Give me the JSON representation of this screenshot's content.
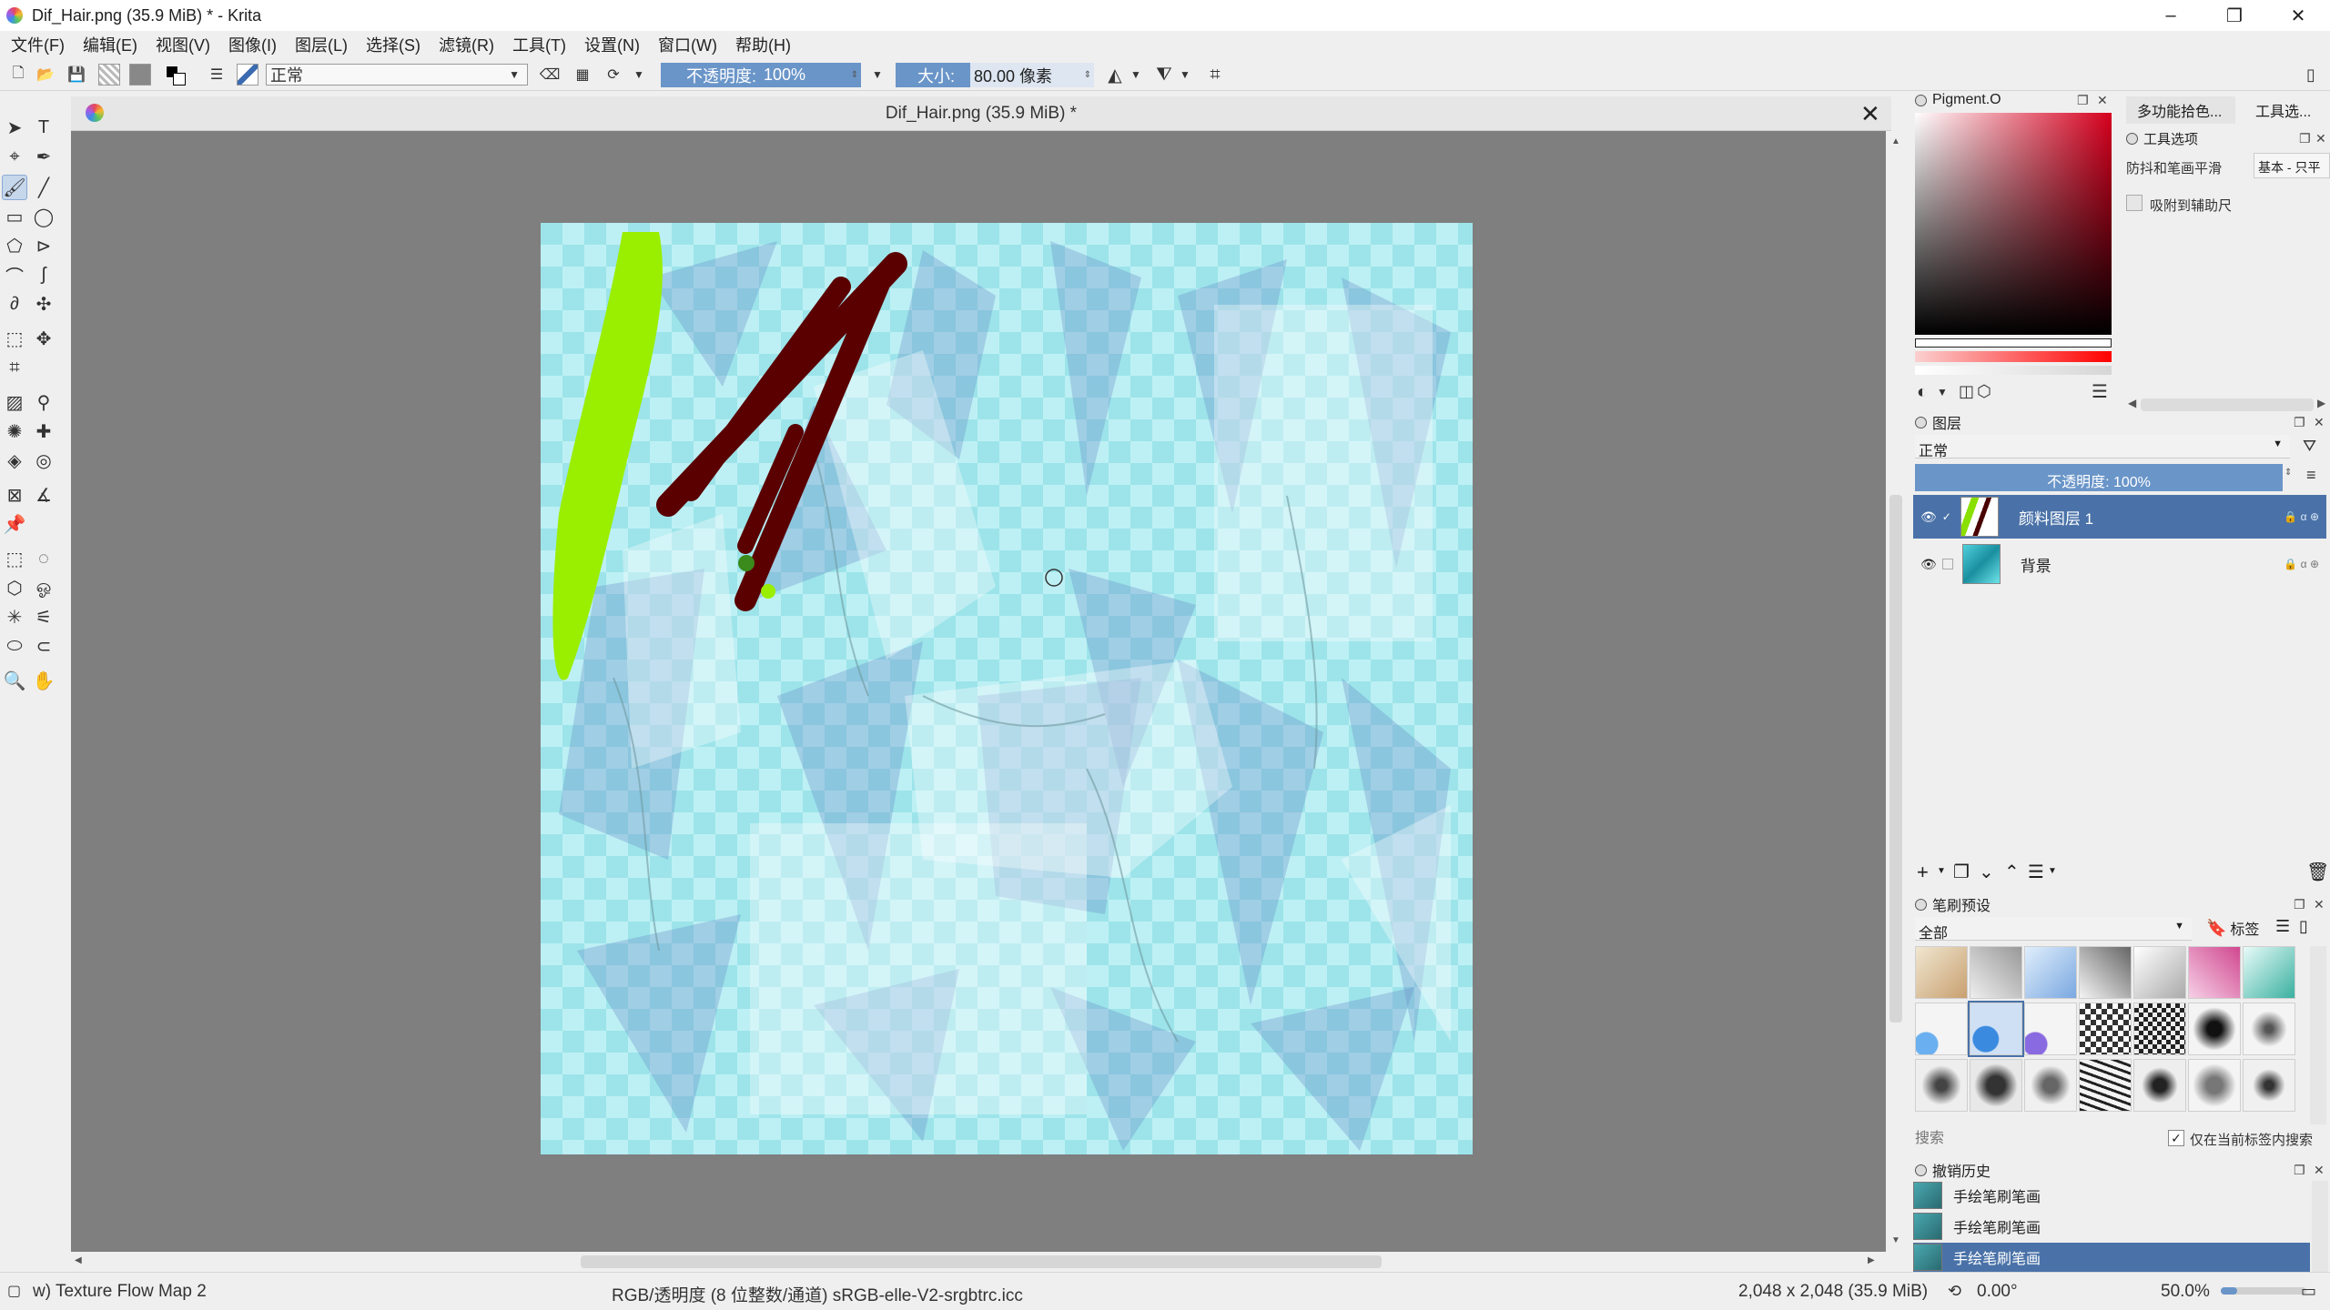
{
  "window": {
    "title": "Dif_Hair.png (35.9 MiB) * - Krita",
    "min": "–",
    "max": "❐",
    "close": "✕"
  },
  "menu": [
    "文件(F)",
    "编辑(E)",
    "视图(V)",
    "图像(I)",
    "图层(L)",
    "选择(S)",
    "滤镜(R)",
    "工具(T)",
    "设置(N)",
    "窗口(W)",
    "帮助(H)"
  ],
  "toolbar": {
    "blend_mode": "正常",
    "opacity_label": "不透明度:",
    "opacity_value": "100%",
    "size_label": "大小:",
    "size_value": "80.00 像素"
  },
  "document": {
    "tab_title": "Dif_Hair.png (35.9 MiB) *"
  },
  "color_docker": {
    "title": "Pigment.O",
    "tab2": "多功能拾色...",
    "tab3": "工具选..."
  },
  "tool_options": {
    "title": "工具选项",
    "smoothing_label": "防抖和笔画平滑",
    "smoothing_value": "基本 - 只平",
    "snap_label": "吸附到辅助尺"
  },
  "layers": {
    "title": "图层",
    "blend_mode": "正常",
    "opacity": "不透明度:  100%",
    "items": [
      {
        "name": "颜料图层 1",
        "selected": true
      },
      {
        "name": "背景",
        "selected": false
      }
    ]
  },
  "brush_presets": {
    "title": "笔刷预设",
    "filter": "全部",
    "tag_label": "标签",
    "search_placeholder": "搜索",
    "search_checkbox": "仅在当前标签内搜索"
  },
  "undo_history": {
    "title": "撤销历史",
    "items": [
      {
        "label": "手绘笔刷笔画",
        "selected": false
      },
      {
        "label": "手绘笔刷笔画",
        "selected": false
      },
      {
        "label": "手绘笔刷笔画",
        "selected": true
      }
    ]
  },
  "status": {
    "brush_name": "w) Texture Flow Map 2",
    "color_space": "RGB/透明度 (8 位整数/通道)  sRGB-elle-V2-srgbtrc.icc",
    "dimensions": "2,048 x 2,048 (35.9 MiB)",
    "rotation": "0.00°",
    "zoom": "50.0%"
  },
  "colors": {
    "accent": "#4a72a8",
    "canvas_bg": "#7f7f7f",
    "texture_cyan": "#9ce4ea",
    "stroke_green": "#9aee00",
    "stroke_red": "#5a0000"
  }
}
